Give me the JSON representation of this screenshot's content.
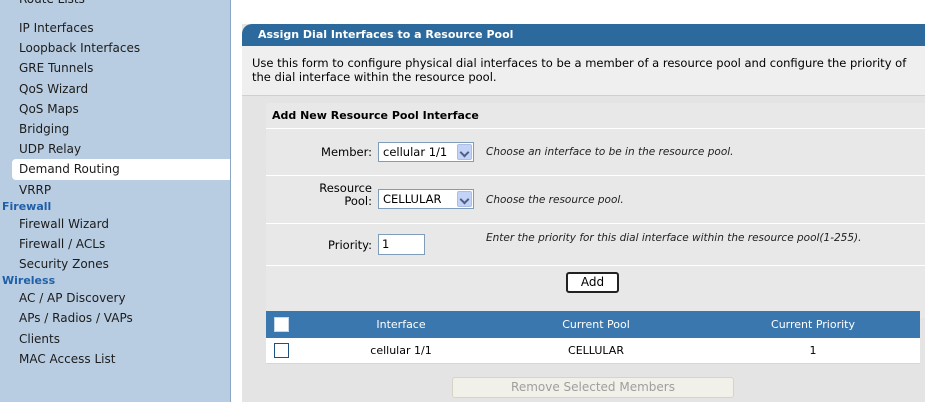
{
  "sidebar": {
    "cut_item": "Route Lists",
    "items": [
      {
        "label": "IP Interfaces"
      },
      {
        "label": "Loopback Interfaces"
      },
      {
        "label": "GRE Tunnels"
      },
      {
        "label": "QoS Wizard"
      },
      {
        "label": "QoS Maps"
      },
      {
        "label": "Bridging"
      },
      {
        "label": "UDP Relay"
      },
      {
        "label": "Demand Routing"
      },
      {
        "label": "VRRP"
      }
    ],
    "firewall": {
      "title": "Firewall",
      "items": [
        {
          "label": "Firewall Wizard"
        },
        {
          "label": "Firewall / ACLs"
        },
        {
          "label": "Security Zones"
        }
      ]
    },
    "wireless": {
      "title": "Wireless",
      "items": [
        {
          "label": "AC / AP Discovery"
        },
        {
          "label": "APs / Radios / VAPs"
        },
        {
          "label": "Clients"
        },
        {
          "label": "MAC Access List"
        }
      ]
    }
  },
  "panel": {
    "title": "Assign Dial Interfaces to a Resource Pool",
    "description": "Use this form to configure physical dial interfaces to be a member of a resource pool and configure the priority of the dial interface within the resource pool."
  },
  "form": {
    "header": "Add New Resource Pool Interface",
    "member": {
      "label": "Member:",
      "value": "cellular 1/1",
      "hint": "Choose an interface to be in the resource pool."
    },
    "resource_pool": {
      "label_line1": "Resource",
      "label_line2": "Pool:",
      "value": "CELLULAR",
      "hint": "Choose the resource pool."
    },
    "priority": {
      "label": "Priority:",
      "value": "1",
      "hint": "Enter the priority for this dial interface within the resource pool(1-255)."
    },
    "add_label": "Add"
  },
  "table": {
    "columns": [
      "Interface",
      "Current Pool",
      "Current Priority"
    ],
    "rows": [
      {
        "interface": "cellular 1/1",
        "pool": "CELLULAR",
        "priority": "1"
      }
    ]
  },
  "remove_label": "Remove Selected Members",
  "colors": {
    "sidebar_bg": "#b9cde2",
    "section_title": "#1f5fa8",
    "panel_title_bg": "#2c6a9d",
    "table_header_bg": "#3a77ae"
  }
}
